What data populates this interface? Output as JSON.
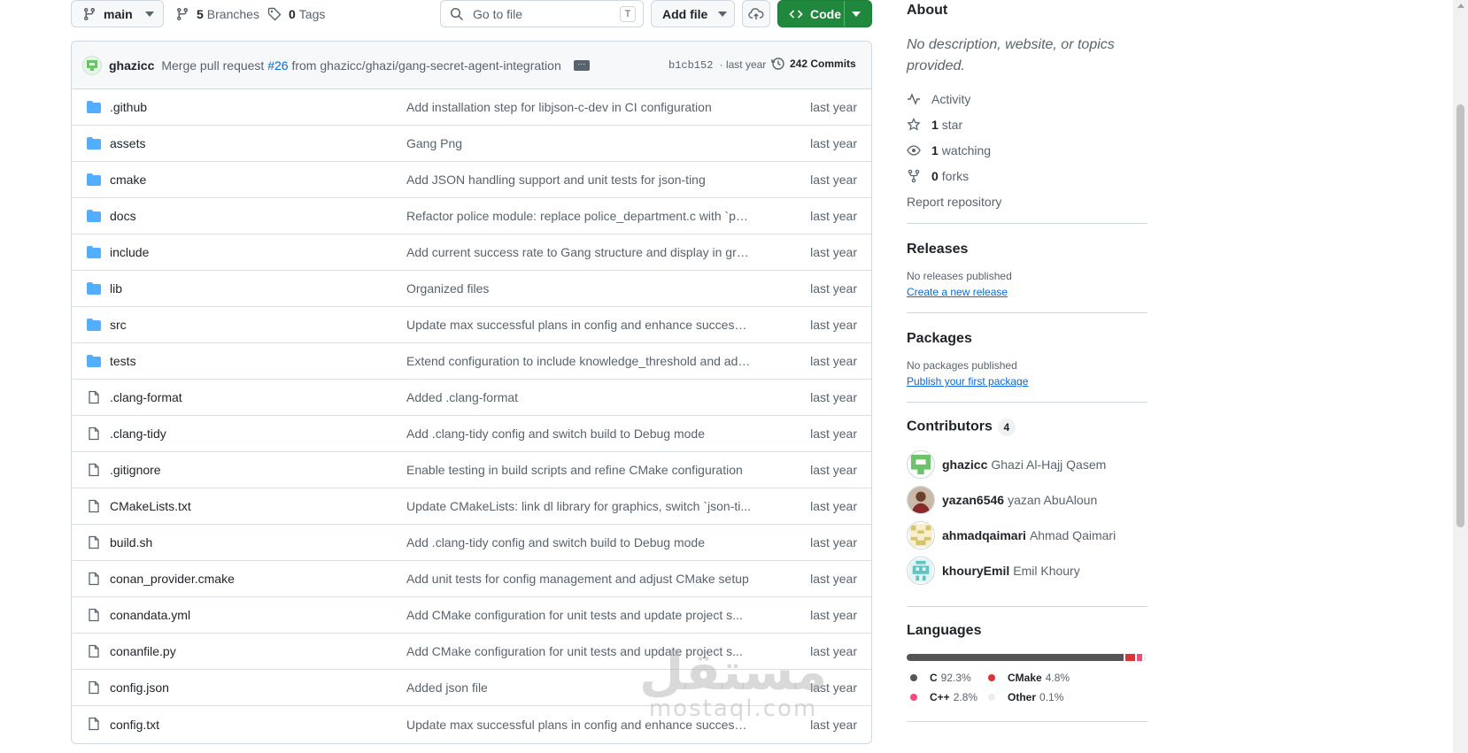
{
  "toolbar": {
    "branch": "main",
    "branches_count": "5",
    "branches_label": "Branches",
    "tags_count": "0",
    "tags_label": "Tags",
    "goto_placeholder": "Go to file",
    "goto_shortcut": "T",
    "add_file_label": "Add file",
    "code_label": "Code"
  },
  "commit": {
    "author": "ghazicc",
    "message_prefix": "Merge pull request",
    "pr": "#26",
    "message_suffix": "from ghazicc/ghazi/gang-secret-agent-integration",
    "sha": "b1cb152",
    "time": "· last year",
    "count_label": "242 Commits"
  },
  "files": [
    {
      "name": ".github",
      "type": "folder",
      "message": "Add installation step for libjson-c-dev in CI configuration",
      "date": "last year"
    },
    {
      "name": "assets",
      "type": "folder",
      "message": "Gang Png",
      "date": "last year"
    },
    {
      "name": "cmake",
      "type": "folder",
      "message": "Add JSON handling support and unit tests for json-ting",
      "date": "last year"
    },
    {
      "name": "docs",
      "type": "folder",
      "message": "Refactor police module: replace police_department.c with `po...",
      "date": "last year"
    },
    {
      "name": "include",
      "type": "folder",
      "message": "Add current success rate to Gang structure and display in gra...",
      "date": "last year"
    },
    {
      "name": "lib",
      "type": "folder",
      "message": "Organized files",
      "date": "last year"
    },
    {
      "name": "src",
      "type": "folder",
      "message": "Update max successful plans in config and enhance success r...",
      "date": "last year"
    },
    {
      "name": "tests",
      "type": "folder",
      "message": "Extend configuration to include knowledge_threshold and ada...",
      "date": "last year"
    },
    {
      "name": ".clang-format",
      "type": "file",
      "message": "Added .clang-format",
      "date": "last year"
    },
    {
      "name": ".clang-tidy",
      "type": "file",
      "message": "Add .clang-tidy config and switch build to Debug mode",
      "date": "last year"
    },
    {
      "name": ".gitignore",
      "type": "file",
      "message": "Enable testing in build scripts and refine CMake configuration",
      "date": "last year"
    },
    {
      "name": "CMakeLists.txt",
      "type": "file",
      "message": "Update CMakeLists: link dl library for graphics, switch `json-ti...",
      "date": "last year"
    },
    {
      "name": "build.sh",
      "type": "file",
      "message": "Add .clang-tidy config and switch build to Debug mode",
      "date": "last year"
    },
    {
      "name": "conan_provider.cmake",
      "type": "file",
      "message": "Add unit tests for config management and adjust CMake setup",
      "date": "last year"
    },
    {
      "name": "conandata.yml",
      "type": "file",
      "message": "Add CMake configuration for unit tests and update project s...",
      "date": "last year"
    },
    {
      "name": "conanfile.py",
      "type": "file",
      "message": "Add CMake configuration for unit tests and update project s...",
      "date": "last year"
    },
    {
      "name": "config.json",
      "type": "file",
      "message": "Added json file",
      "date": "last year"
    },
    {
      "name": "config.txt",
      "type": "file",
      "message": "Update max successful plans in config and enhance success r...",
      "date": "last year"
    }
  ],
  "about": {
    "title": "About",
    "description": "No description, website, or topics provided.",
    "activity": "Activity",
    "stars_count": "1",
    "stars_label": "star",
    "watching_count": "1",
    "watching_label": "watching",
    "forks_count": "0",
    "forks_label": "forks",
    "report": "Report repository"
  },
  "releases": {
    "title": "Releases",
    "empty": "No releases published",
    "link": "Create a new release"
  },
  "packages": {
    "title": "Packages",
    "empty": "No packages published",
    "link": "Publish your first package"
  },
  "contributors": {
    "title": "Contributors",
    "count": "4",
    "list": [
      {
        "login": "ghazicc",
        "name": "Ghazi Al-Hajj Qasem"
      },
      {
        "login": "yazan6546",
        "name": "yazan AbuAloun"
      },
      {
        "login": "ahmadqaimari",
        "name": "Ahmad Qaimari"
      },
      {
        "login": "khouryEmil",
        "name": "Emil Khoury"
      }
    ]
  },
  "languages": {
    "title": "Languages",
    "list": [
      {
        "name": "C",
        "percent": "92.3%",
        "value": 92.3,
        "color": "#555555"
      },
      {
        "name": "CMake",
        "percent": "4.8%",
        "value": 4.8,
        "color": "#DA3434"
      },
      {
        "name": "C++",
        "percent": "2.8%",
        "value": 2.8,
        "color": "#f34b7d"
      },
      {
        "name": "Other",
        "percent": "0.1%",
        "value": 0.1,
        "color": "#ededed"
      }
    ]
  },
  "watermark": {
    "line1": "مستقل",
    "line2": "mostaql.com"
  },
  "colors": {
    "folder": "#54aeff",
    "file": "#59636e",
    "primary": "#1f883d",
    "link": "#0969da"
  }
}
